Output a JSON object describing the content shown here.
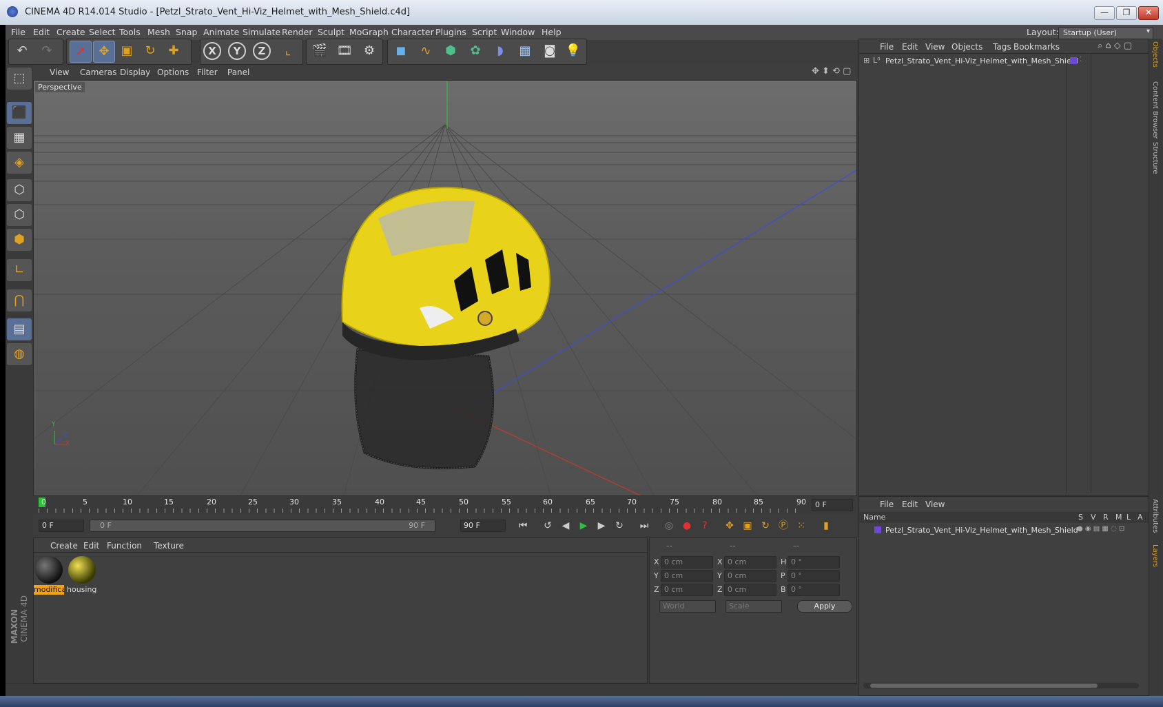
{
  "window": {
    "title": "CINEMA 4D R14.014 Studio - [Petzl_Strato_Vent_Hi-Viz_Helmet_with_Mesh_Shield.c4d]",
    "minimize": "—",
    "maximize": "❐",
    "close": "✕"
  },
  "menubar": {
    "items": [
      "File",
      "Edit",
      "Create",
      "Select",
      "Tools",
      "Mesh",
      "Snap",
      "Animate",
      "Simulate",
      "Render",
      "Sculpt",
      "MoGraph",
      "Character",
      "Plugins",
      "Script",
      "Window",
      "Help"
    ],
    "layout_label": "Layout:",
    "layout_value": "Startup (User)"
  },
  "toolbar": {
    "axis_x": "X",
    "axis_y": "Y",
    "axis_z": "Z"
  },
  "viewport": {
    "menu": [
      "View",
      "Cameras",
      "Display",
      "Options",
      "Filter",
      "Panel"
    ],
    "label": "Perspective",
    "axis_y": "Y",
    "axis_x": "X",
    "axis_z": "Z"
  },
  "timeline": {
    "ticks": [
      "0",
      "5",
      "10",
      "15",
      "20",
      "25",
      "30",
      "35",
      "40",
      "45",
      "50",
      "55",
      "60",
      "65",
      "70",
      "75",
      "80",
      "85",
      "90"
    ],
    "current_frame": "0 F",
    "start_field": "0 F",
    "range_start": "0 F",
    "range_end": "90 F",
    "end_field": "90 F"
  },
  "material_manager": {
    "menu": [
      "Create",
      "Edit",
      "Function",
      "Texture"
    ],
    "materials": [
      {
        "name": "modifica"
      },
      {
        "name": "housing"
      }
    ]
  },
  "coordinates": {
    "headers": [
      "--",
      "--",
      "--"
    ],
    "rows": [
      {
        "a": "X",
        "av": "0 cm",
        "b": "X",
        "bv": "0 cm",
        "c": "H",
        "cv": "0 °"
      },
      {
        "a": "Y",
        "av": "0 cm",
        "b": "Y",
        "bv": "0 cm",
        "c": "P",
        "cv": "0 °"
      },
      {
        "a": "Z",
        "av": "0 cm",
        "b": "Z",
        "bv": "0 cm",
        "c": "B",
        "cv": "0 °"
      }
    ],
    "mode1": "World",
    "mode2": "Scale",
    "apply": "Apply"
  },
  "object_manager": {
    "menu": [
      "File",
      "Edit",
      "View",
      "Objects",
      "Tags",
      "Bookmarks"
    ],
    "object_name": "Petzl_Strato_Vent_Hi-Viz_Helmet_with_Mesh_Shield",
    "tabs": [
      "Objects",
      "Content Browser",
      "Structure"
    ]
  },
  "layer_manager": {
    "menu": [
      "File",
      "Edit",
      "View"
    ],
    "col_name": "Name",
    "cols": [
      "S",
      "V",
      "R",
      "M",
      "L",
      "A"
    ],
    "object_name": "Petzl_Strato_Vent_Hi-Viz_Helmet_with_Mesh_Shield",
    "tabs": [
      "Attributes",
      "Layers"
    ]
  },
  "branding": {
    "maxon": "MAXON",
    "product": "CINEMA 4D"
  },
  "colors": {
    "accent": "#5a6f96",
    "helmet": "#e8d21a",
    "grid_blue": "#3a4fd6",
    "grid_red": "#c83a2a",
    "grid_green": "#2fbf3a"
  }
}
